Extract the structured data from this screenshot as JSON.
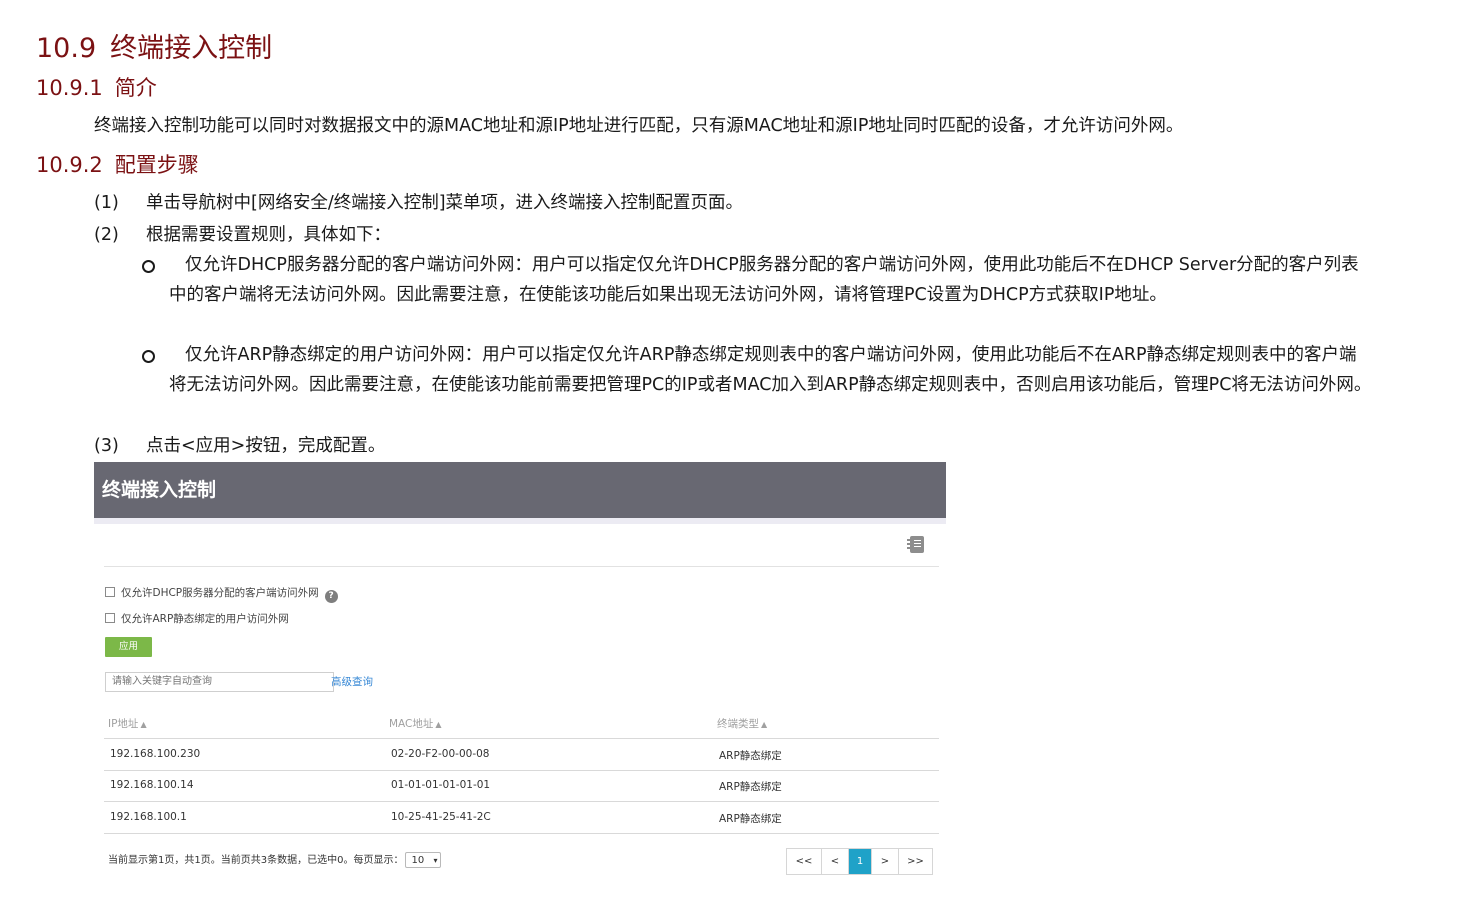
{
  "doc": {
    "h1": {
      "num": "10.9",
      "title": "终端接入控制"
    },
    "intro": {
      "num": "10.9.1",
      "title": "简介",
      "text": "终端接入控制功能可以同时对数据报文中的源MAC地址和源IP地址进行匹配，只有源MAC地址和源IP地址同时匹配的设备，才允许访问外网。"
    },
    "steps_section": {
      "num": "10.9.2",
      "title": "配置步骤"
    },
    "steps": [
      {
        "num": "(1)",
        "text": "单击导航树中[网络安全/终端接入控制]菜单项，进入终端接入控制配置页面。"
      },
      {
        "num": "(2)",
        "text": "根据需要设置规则，具体如下："
      },
      {
        "num": "(3)",
        "text": "点击<应用>按钮，完成配置。"
      }
    ],
    "bullets": [
      "仅允许DHCP服务器分配的客户端访问外网：用户可以指定仅允许DHCP服务器分配的客户端访问外网，使用此功能后不在DHCP Server分配的客户列表中的客户端将无法访问外网。因此需要注意，在使能该功能后如果出现无法访问外网，请将管理PC设置为DHCP方式获取IP地址。",
      "仅允许ARP静态绑定的用户访问外网：用户可以指定仅允许ARP静态绑定规则表中的客户端访问外网，使用此功能后不在ARP静态绑定规则表中的客户端将无法访问外网。因此需要注意，在使能该功能前需要把管理PC的IP或者MAC加入到ARP静态绑定规则表中，否则启用该功能后，管理PC将无法访问外网。"
    ]
  },
  "screenshot": {
    "title": "终端接入控制",
    "options": [
      {
        "label": "仅允许DHCP服务器分配的客户端访问外网",
        "checked": false
      },
      {
        "label": "仅允许ARP静态绑定的用户访问外网",
        "checked": false
      }
    ],
    "help_glyph": "?",
    "apply_label": "应用",
    "search_placeholder": "请输入关键字自动查询",
    "advanced_search": "高级查询",
    "columns": [
      "IP地址",
      "MAC地址",
      "终端类型"
    ],
    "sort_glyph": "▲",
    "rows": [
      [
        "192.168.100.230",
        "02-20-F2-00-00-08",
        "ARP静态绑定"
      ],
      [
        "192.168.100.14",
        "01-01-01-01-01-01",
        "ARP静态绑定"
      ],
      [
        "192.168.100.1",
        "10-25-41-25-41-2C",
        "ARP静态绑定"
      ]
    ],
    "footer_text": "当前显示第1页，共1页。当前页共3条数据，已选中0。每页显示：",
    "page_size": "10",
    "page_size_arrow": "▾",
    "pager": {
      "first": "<<",
      "prev": "<",
      "current": "1",
      "next": ">",
      "last": ">>"
    },
    "colors": {
      "header_bg": "#686872",
      "apply_bg": "#7cb848",
      "pager_active": "#1fa2c8",
      "link": "#3a8ad6"
    }
  },
  "colors": {
    "heading": "#7b1113"
  }
}
